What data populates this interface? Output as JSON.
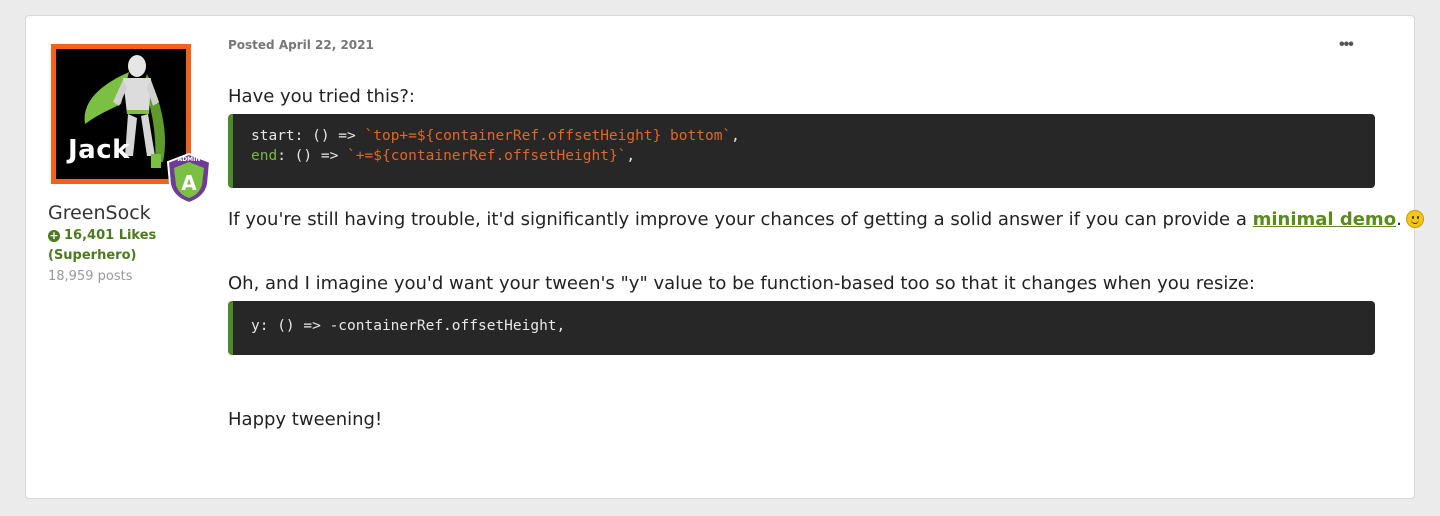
{
  "author": {
    "avatar_text": "Jack",
    "badge_text": "ADMIN",
    "badge_letter": "A",
    "username": "GreenSock",
    "likes": "16,401 Likes",
    "rank": "(Superhero)",
    "post_count": "18,959 posts"
  },
  "post": {
    "date": "Posted April 22, 2021",
    "menu_label": "•••",
    "intro": "Have you tried this?:",
    "code1": {
      "line1_key": "start",
      "line1_mid": ": () => ",
      "line1_str": "`top+=${containerRef.offsetHeight} bottom`",
      "line1_end": ",",
      "line2_key": "end",
      "line2_mid": ": () => ",
      "line2_str": "`+=${containerRef.offsetHeight}`",
      "line2_end": ","
    },
    "help_before": "If you're still having trouble, it'd significantly improve your chances of getting a solid answer if you can provide a ",
    "help_link": "minimal demo",
    "help_after": ".",
    "tween_note": "Oh, and I imagine you'd want your tween's \"y\" value to be function-based too so that it changes when you resize:",
    "code2": "y: () => -containerRef.offsetHeight,",
    "signoff": "Happy tweening!"
  },
  "colors": {
    "accent_green": "#4c7a1f",
    "avatar_border": "#f4611e",
    "code_bg": "#272727",
    "code_string": "#e0672a"
  }
}
